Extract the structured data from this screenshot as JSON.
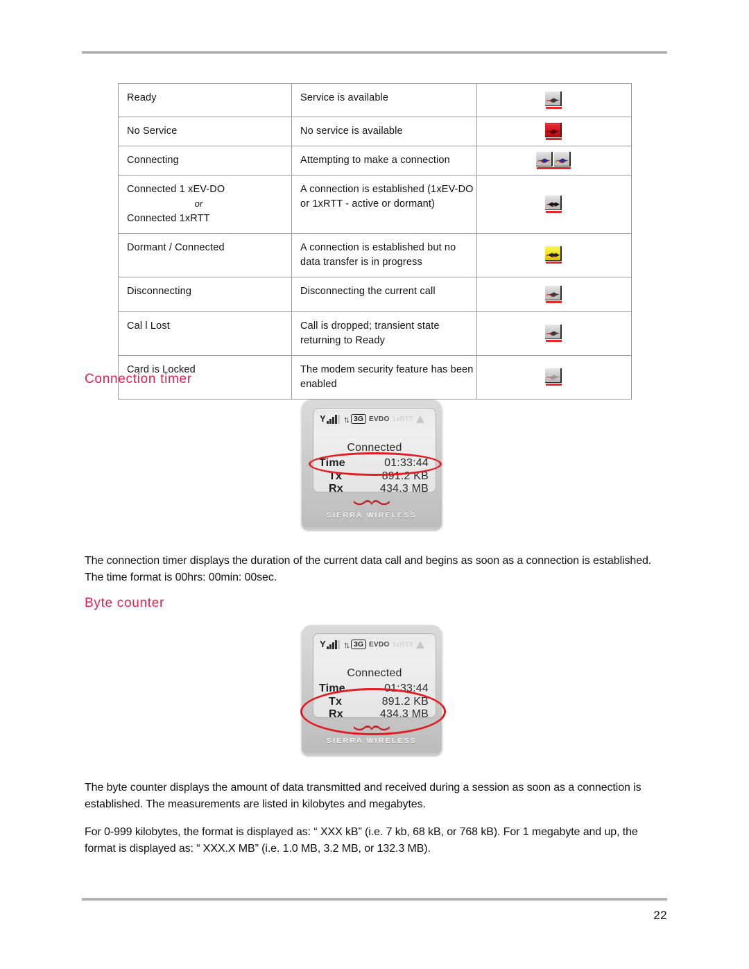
{
  "document": {
    "page_number": "22"
  },
  "status_table": {
    "rows": [
      {
        "state": "Ready",
        "state_alt": "",
        "or_label": "",
        "description": "Service is available",
        "icon": "modem-gray-icon"
      },
      {
        "state": "No Service",
        "state_alt": "",
        "or_label": "",
        "description": "No service is available",
        "icon": "modem-red-icon"
      },
      {
        "state": "Connecting",
        "state_alt": "",
        "or_label": "",
        "description": "Attempting to make a connection",
        "icon": "modem-dual-gray-icon"
      },
      {
        "state": "Connected 1 xEV-DO",
        "state_alt": "Connected 1xRTT",
        "or_label": "or",
        "description": "A connection is established (1xEV-DO or 1xRTT - active or dormant)",
        "icon": "modem-connected-icon"
      },
      {
        "state": "Dormant / Connected",
        "state_alt": "",
        "or_label": "",
        "description": "A connection is established but no data transfer is in progress",
        "icon": "modem-yellow-icon"
      },
      {
        "state": "Disconnecting",
        "state_alt": "",
        "or_label": "",
        "description": "Disconnecting the current call",
        "icon": "modem-gray-icon"
      },
      {
        "state": "Cal l Lost",
        "state_alt": "",
        "or_label": "",
        "description": "Call is dropped; transient state returning to Ready",
        "icon": "modem-gray-icon"
      },
      {
        "state": "Card is Locked",
        "state_alt": "",
        "or_label": "",
        "description": "The modem security feature has been enabled",
        "icon": "modem-locked-icon"
      }
    ]
  },
  "sections": {
    "connection_timer": {
      "heading": "Connection timer",
      "body": "The connection timer displays the duration of the current data call and begins as soon as a connection is established. The time format is 00hrs: 00min: 00sec."
    },
    "byte_counter": {
      "heading": "Byte counter",
      "body": "The byte counter displays the amount of data transmitted and received during a session as soon as a connection is established. The measurements are listed in kilobytes and megabytes.",
      "format_note": "For 0-999 kilobytes, the format is displayed as: “ XXX kB” (i.e. 7 kb, 68 kB, or 768 kB). For 1 megabyte and up, the format is displayed as: “ XXX.X MB” (i.e. 1.0 MB, 3.2 MB, or 132.3 MB)."
    }
  },
  "device_display": {
    "status_bar": {
      "signal_icon": "signal-bars-icon",
      "traffic_icon": "up-down-arrows-icon",
      "network_tag": "3G",
      "evdo_label": "EVDO",
      "rtt_label": "1xRTT",
      "triangle_icon": "triangle-icon"
    },
    "state": "Connected",
    "rows": [
      {
        "label": "Time",
        "value": "01:33:44"
      },
      {
        "label": "Tx",
        "value": "891.2 KB"
      },
      {
        "label": "Rx",
        "value": "434.3 MB"
      }
    ],
    "brand": "SIERRA WIRELESS"
  },
  "colors": {
    "heading_red": "#ec1a4d",
    "annotation_red": "#e51b23",
    "rule_gray": "#b6b6b6"
  }
}
